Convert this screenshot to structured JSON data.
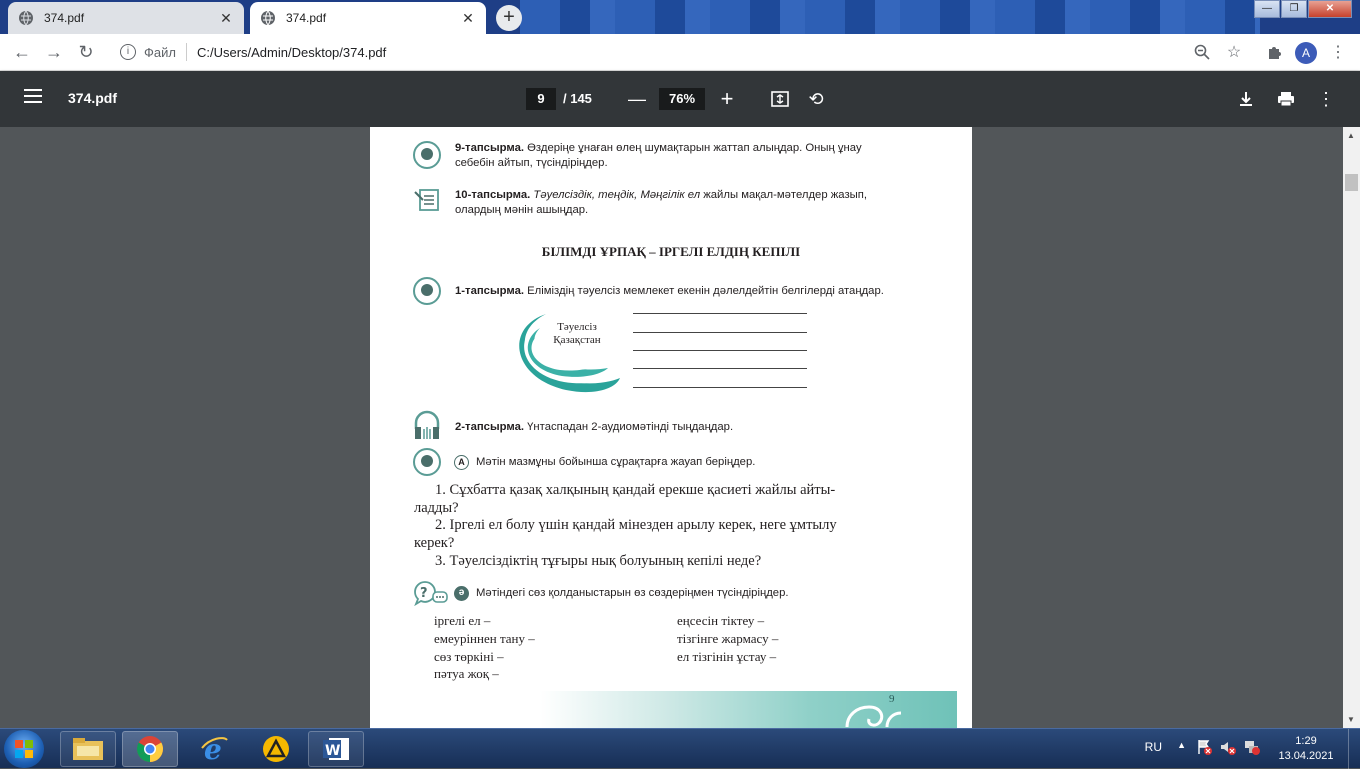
{
  "browser": {
    "tabs": [
      {
        "title": "374.pdf",
        "active": false
      },
      {
        "title": "374.pdf",
        "active": true
      }
    ],
    "new_tab": "+",
    "address": {
      "scheme_label": "Файл",
      "url": "C:/Users/Admin/Desktop/374.pdf"
    },
    "avatar_letter": "A"
  },
  "pdf_toolbar": {
    "file_name": "374.pdf",
    "current_page": "9",
    "total_pages": "/ 145",
    "zoom": "76%"
  },
  "page": {
    "task9": {
      "label": "9-тапсырма.",
      "text1": " Өздеріңе ұнаған өлең шумақтарын жаттап алыңдар. Оның ұнау",
      "text2": "себебін айтып, түсіндіріңдер."
    },
    "task10": {
      "label": "10-тапсырма.",
      "italic": " Тәуелсіздік, теңдік, Мәңгілік ел",
      "text1": " жайлы мақал-мәтелдер жазып,",
      "text2": "олардың мәнін ашыңдар."
    },
    "heading": "БІЛІМДІ  ҰРПАҚ  –  ІРГЕЛІ  ЕЛДІҢ  КЕПІЛІ",
    "task1": {
      "label": "1-тапсырма.",
      "text": " Еліміздің тәуелсіз мемлекет екенін дәлелдейтін белгілерді атаңдар."
    },
    "emblem": {
      "line1": "Тәуелсіз",
      "line2": "Қазақстан"
    },
    "task2": {
      "label": "2-тапсырма.",
      "text": " Үнтаспадан 2-аудиомәтінді тыңдаңдар."
    },
    "partA": {
      "letter": "А",
      "text": "Мәтін мазмұны бойынша сұрақтарға жауап беріңдер."
    },
    "questions": [
      "1. Сұхбатта  қазақ  халқының   қандай  ерекше  қасиеті  жайлы  айты-",
      "ладды?",
      "2. Іргелі  ел болу  үшін  қандай  мінезден  арылу  керек,  неге  ұмтылу",
      "керек?",
      "3. Тәуелсіздіктің    тұғыры   нық  болуының   кепілі   неде?"
    ],
    "partAe": {
      "letter": "ә",
      "text": "Мәтіндегі сөз қолданыстарын өз сөздеріңмен түсіндіріңдер."
    },
    "vocab_left": [
      "іргелі   ел  –",
      "емеуріннен    тану  –",
      "сөз  төркіні   –",
      "пәтуа  жоқ  –"
    ],
    "vocab_right": [
      "еңсесін   тіктеу   –",
      "тізгінге   жармасу   –",
      "ел  тізгінін   ұстау  –"
    ],
    "page_number": "9"
  },
  "taskbar": {
    "lang": "RU",
    "time": "1:29",
    "date": "13.04.2021"
  }
}
